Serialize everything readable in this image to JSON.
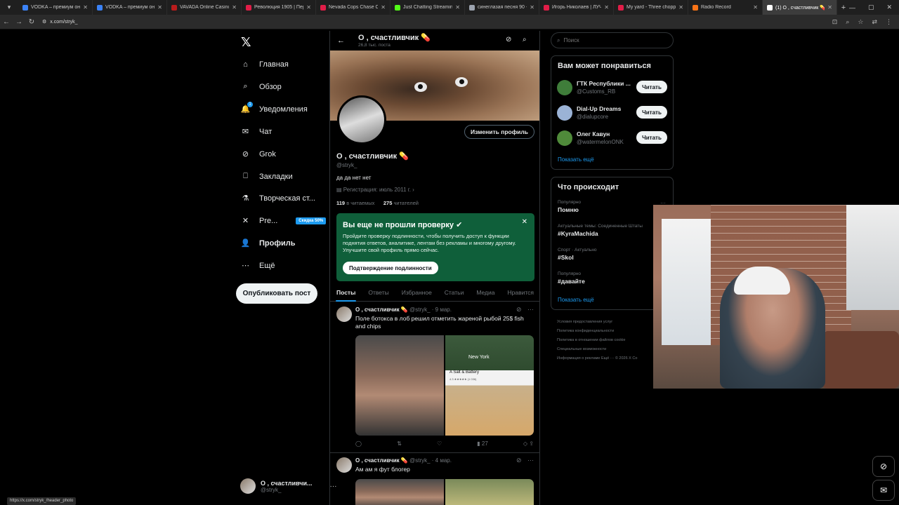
{
  "browser": {
    "tabs": [
      {
        "title": "VODKA – премиум онлайн",
        "color": "#3b82f6"
      },
      {
        "title": "VODKA – премиум онлайн",
        "color": "#3b82f6"
      },
      {
        "title": "VAVADA Online Casino",
        "color": "#b91c1c"
      },
      {
        "title": "Революция 1905 | Перв",
        "color": "#e11d48"
      },
      {
        "title": "Nevada Cops Chase Chil",
        "color": "#e11d48"
      },
      {
        "title": "Just Chatting Streaming",
        "color": "#53fc18"
      },
      {
        "title": "синеглазая песня 90 - G",
        "color": "#9ca3af"
      },
      {
        "title": "Игорь Николаев | ЛУЧШ",
        "color": "#e11d48"
      },
      {
        "title": "My yard - Three chopper",
        "color": "#e11d48"
      },
      {
        "title": "Radio Record",
        "color": "#f97316"
      },
      {
        "title": "(1) О , счастливчик 💊 (@",
        "color": "#ffffff"
      }
    ],
    "url": "x.com/stryk_",
    "status_url": "https://x.com/stryk_/header_photo"
  },
  "nav": {
    "items": [
      {
        "label": "Главная",
        "icon": "home-icon"
      },
      {
        "label": "Обзор",
        "icon": "search-icon"
      },
      {
        "label": "Уведомления",
        "icon": "bell-icon"
      },
      {
        "label": "Чат",
        "icon": "mail-icon"
      },
      {
        "label": "Grok",
        "icon": "grok-icon"
      },
      {
        "label": "Закладки",
        "icon": "bookmark-icon"
      },
      {
        "label": "Творческая ст...",
        "icon": "flask-icon"
      },
      {
        "label": "Pre...",
        "icon": "x-icon"
      },
      {
        "label": "Профиль",
        "icon": "person-icon"
      },
      {
        "label": "Ещё",
        "icon": "more-icon"
      }
    ],
    "notif_badge": "1",
    "premium_badge": "Скидка 50%",
    "post_button": "Опубликовать пост",
    "account": {
      "name": "О , счастливчи...",
      "handle": "@stryk_"
    }
  },
  "profile": {
    "header_name": "О , счастливчик 💊",
    "post_count": "26,8 тыс. поста",
    "edit_button": "Изменить профиль",
    "name": "О , счастливчик 💊",
    "handle": "@stryk_",
    "bio": "да да нет нет",
    "joined": "Регистрация: июль 2011 г.",
    "following_count": "119",
    "following_label": "в читаемых",
    "followers_count": "275",
    "followers_label": "читателей"
  },
  "verify": {
    "title": "Вы еще не прошли проверку",
    "text": "Пройдите проверку подлинности, чтобы получить доступ к функции поднятия ответов, аналитике, лентам без рекламы и многому другому. Улучшите свой профиль прямо сейчас.",
    "button": "Подтверждение подлинности"
  },
  "tabs": [
    "Посты",
    "Ответы",
    "Избранное",
    "Статьи",
    "Медиа",
    "Нравится"
  ],
  "posts": [
    {
      "name": "О , счастливчик 💊",
      "handle": "@stryk_",
      "date": "· 9 мар.",
      "text": "Поле ботокса в лоб решил отметить жареной рыбой 25$ fish and chips",
      "views": "27",
      "map_city": "New York",
      "place_name": "A Salt & Battery",
      "place_rating": "4.3 ★★★★★ (1 036)"
    },
    {
      "name": "О , счастливчик 💊",
      "handle": "@stryk_",
      "date": "· 4 мар.",
      "text": "Ам ам я фут блогер"
    }
  ],
  "right": {
    "search_placeholder": "Поиск",
    "suggest_title": "Вам может понравиться",
    "suggestions": [
      {
        "name": "ГТК Республики ...",
        "handle": "@Customs_RB",
        "color": "#3f7d3a"
      },
      {
        "name": "Dial-Up Dreams",
        "handle": "@dialupcore",
        "color": "#9bb3d6"
      },
      {
        "name": "Олег Кавун",
        "handle": "@watermelonONK",
        "color": "#4f8a3a"
      }
    ],
    "follow_label": "Читать",
    "show_more": "Показать ещё",
    "trends_title": "Что происходит",
    "trends": [
      {
        "category": "Популярно",
        "name": "Помню"
      },
      {
        "category": "Актуальные темы: Соединенные Штаты",
        "name": "#KyraMachida"
      },
      {
        "category": "Спорт · Актуально",
        "name": "#Skol"
      },
      {
        "category": "Популярно",
        "name": "#давайте"
      }
    ],
    "trends_more": "···",
    "footer": [
      "Условия предоставления услуг",
      "Политика конфиденциальности",
      "Политика в отношении файлов cookie",
      "Специальные возможности",
      "Информация о рекламе",
      "Ещё ···",
      "© 2026 X Co"
    ]
  },
  "colors": {
    "accent": "#1d9bf0",
    "verify_bg": "#0f5f3a",
    "background": "#000000"
  }
}
